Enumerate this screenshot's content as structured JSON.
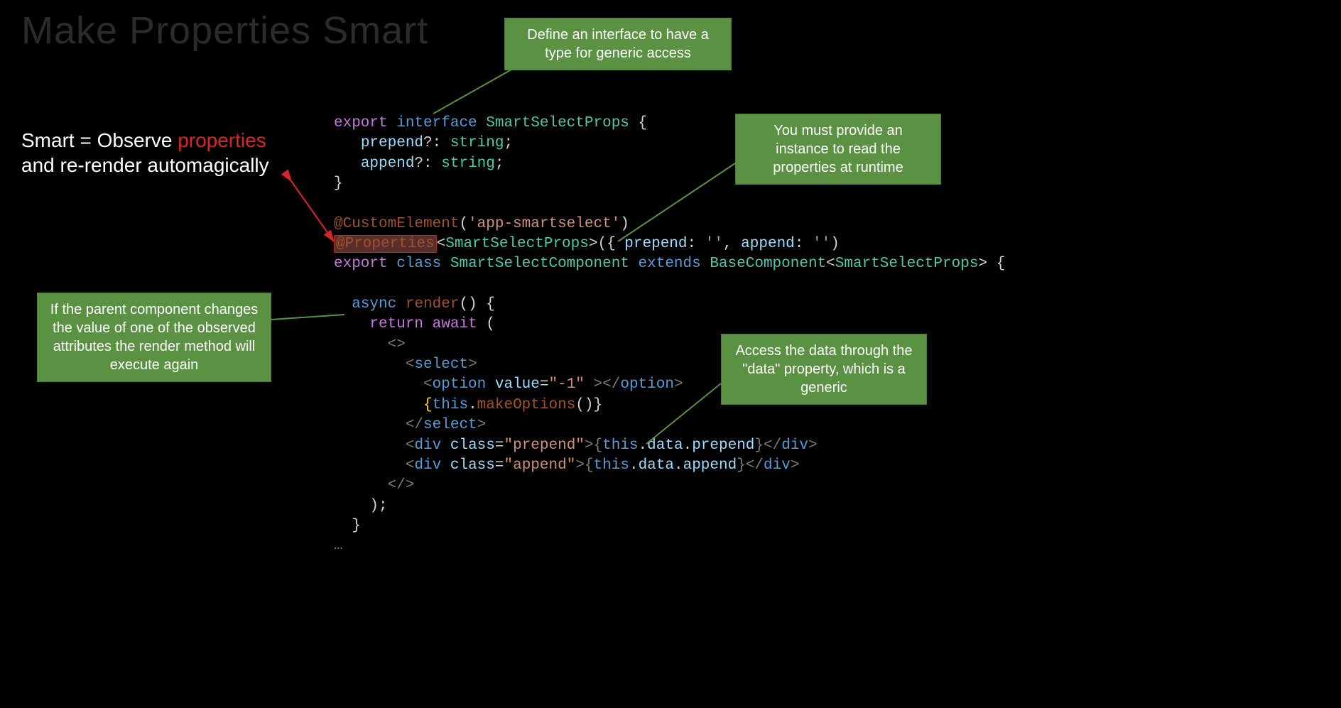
{
  "slide": {
    "title": "Make Properties Smart",
    "subtext_pre": "Smart = Observe ",
    "subtext_hl": "properties",
    "subtext_post": "and re-render automagically"
  },
  "callouts": {
    "c1": "Define an interface to have a type for generic access",
    "c2": "You must provide an instance to read the properties at runtime",
    "c3": "If the parent component changes the value of one of the observed attributes the render method will execute again",
    "c4": "Access the data through the \"data\" property, which is a generic"
  },
  "code": {
    "l1a": "export",
    "l1b": "interface",
    "l1c": "SmartSelectProps",
    "l1d": "{",
    "l2a": "prepend",
    "l2b": "?:",
    "l2c": "string",
    "l2d": ";",
    "l3a": "append",
    "l3b": "?:",
    "l3c": "string",
    "l3d": ";",
    "l4": "}",
    "l6a": "@CustomElement",
    "l6b": "(",
    "l6c": "'app-smartselect'",
    "l6d": ")",
    "l7a": "@Properties",
    "l7b": "<",
    "l7c": "SmartSelectProps",
    "l7d": ">({ ",
    "l7e": "prepend",
    "l7f": ": ",
    "l7g": "''",
    "l7h": ", ",
    "l7i": "append",
    "l7j": ": ",
    "l7k": "''",
    "l7l": ")",
    "l8a": "export",
    "l8b": "class",
    "l8c": "SmartSelectComponent",
    "l8d": "extends",
    "l8e": "BaseComponent",
    "l8f": "<",
    "l8g": "SmartSelectProps",
    "l8h": "> {",
    "l10a": "async",
    "l10b": "render",
    "l10c": "() {",
    "l11a": "return",
    "l11b": "await",
    "l11c": " (",
    "l12": "<>",
    "l13a": "<",
    "l13b": "select",
    "l13c": ">",
    "l14a": "<",
    "l14b": "option",
    "l14c": " ",
    "l14d": "value",
    "l14e": "=",
    "l14f": "\"-1\"",
    "l14g": " ></",
    "l14h": "option",
    "l14i": ">",
    "l15a": "{",
    "l15b": "this",
    "l15c": ".",
    "l15d": "makeOptions",
    "l15e": "()}",
    "l16a": "</",
    "l16b": "select",
    "l16c": ">",
    "l17a": "<",
    "l17b": "div",
    "l17c": " ",
    "l17d": "class",
    "l17e": "=",
    "l17f": "\"prepend\"",
    "l17g": ">{",
    "l17h": "this",
    "l17i": ".",
    "l17j": "data",
    "l17k": ".",
    "l17l": "prepend",
    "l17m": "}</",
    "l17n": "div",
    "l17o": ">",
    "l18a": "<",
    "l18b": "div",
    "l18c": " ",
    "l18d": "class",
    "l18e": "=",
    "l18f": "\"append\"",
    "l18g": ">{",
    "l18h": "this",
    "l18i": ".",
    "l18j": "data",
    "l18k": ".",
    "l18l": "append",
    "l18m": "}</",
    "l18n": "div",
    "l18o": ">",
    "l19": "</>",
    "l20": ");",
    "l21": "}",
    "ellipsis": "…"
  }
}
